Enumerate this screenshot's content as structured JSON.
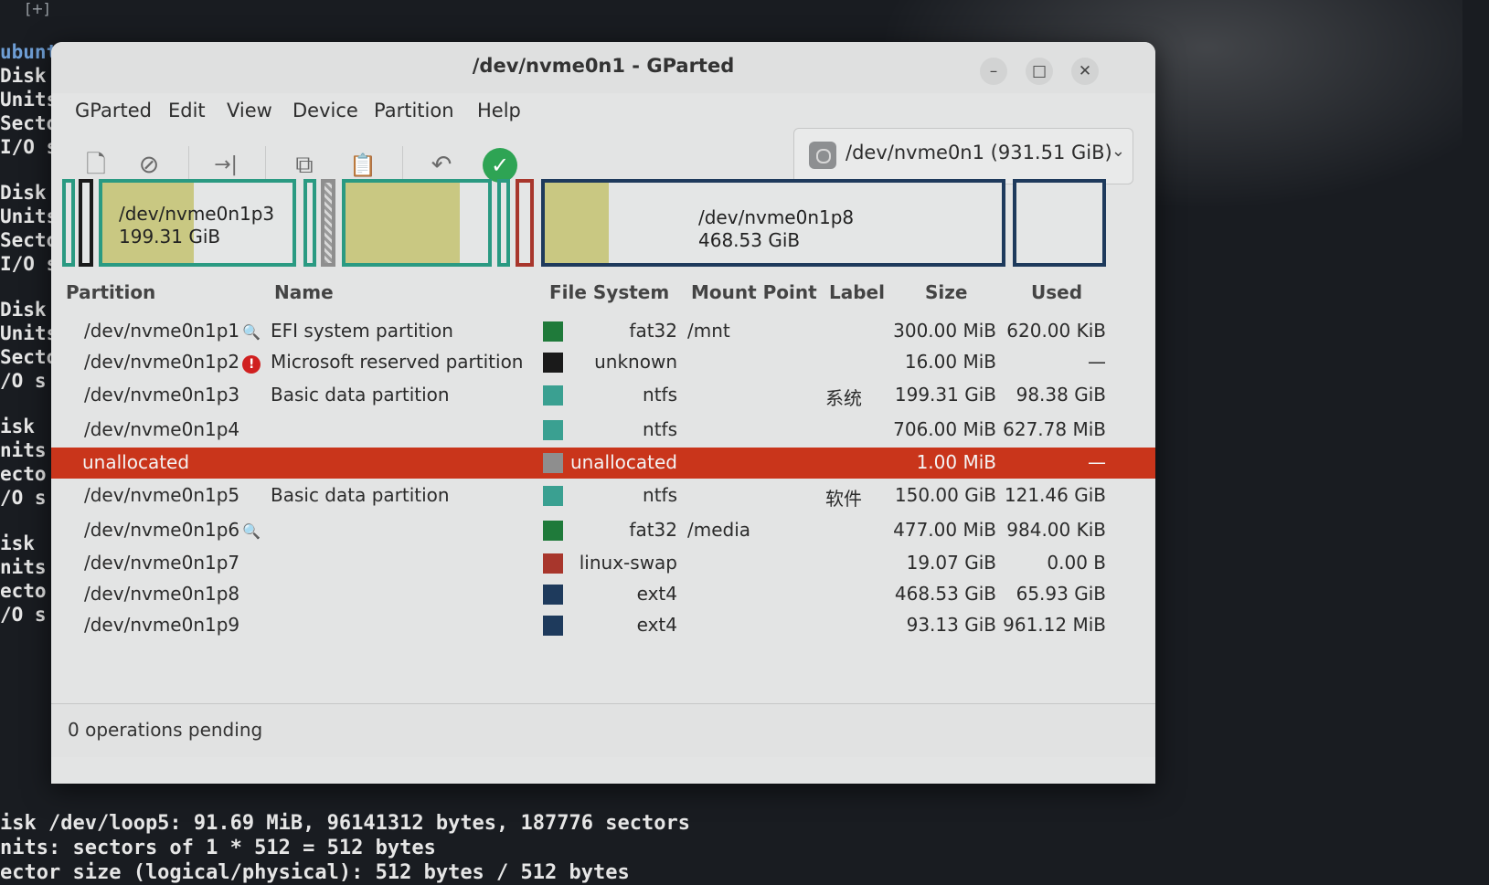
{
  "terminal": {
    "tab_icon": "[+]",
    "side_lines": [
      "ubuntu",
      "Disk ",
      "Units",
      "Secto",
      "I/O s",
      "",
      "Disk ",
      "Units",
      "Secto",
      "I/O s",
      "",
      "Disk ",
      "Units",
      "Secto",
      "/O s",
      "",
      "isk ",
      "nits ",
      "ecto",
      "/O s",
      "",
      "isk ",
      "nits ",
      "ecto",
      "/O s"
    ],
    "bottom_lines": [
      "isk /dev/loop5: 91.69 MiB, 96141312 bytes, 187776 sectors",
      "nits: sectors of 1 * 512 = 512 bytes",
      "ector size (logical/physical): 512 bytes / 512 bytes"
    ]
  },
  "window": {
    "title": "/dev/nvme0n1 - GParted",
    "controls": {
      "minimize": "–",
      "maximize": "□",
      "close": "✕"
    }
  },
  "menu": [
    "GParted",
    "Edit",
    "View",
    "Device",
    "Partition",
    "Help"
  ],
  "toolbar": {
    "new_icon": "🗋",
    "delete_icon": "⊘",
    "resize_icon": "→|",
    "copy_icon": "⧉",
    "paste_icon": "📋",
    "undo_icon": "↶",
    "apply_icon": "✓"
  },
  "device_selector": {
    "value": "/dev/nvme0n1 (931.51 GiB)",
    "chevron": "⌄"
  },
  "disk_map": {
    "p3": {
      "name": "/dev/nvme0n1p3",
      "size": "199.31 GiB"
    },
    "p8": {
      "name": "/dev/nvme0n1p8",
      "size": "468.53 GiB"
    }
  },
  "columns": [
    "Partition",
    "Name",
    "File System",
    "Mount Point",
    "Label",
    "Size",
    "Used"
  ],
  "rows": [
    {
      "partition": "/dev/nvme0n1p1",
      "flag": "🔍",
      "name": "EFI system partition",
      "fs": "fat32",
      "fs_color": "#1f7a3a",
      "mount": "/mnt",
      "label": "",
      "size": "300.00 MiB",
      "used": "620.00 KiB"
    },
    {
      "partition": "/dev/nvme0n1p2",
      "flag": "!",
      "name": "Microsoft reserved partition",
      "fs": "unknown",
      "fs_color": "#1a1a1a",
      "mount": "",
      "label": "",
      "size": "16.00 MiB",
      "used": "—"
    },
    {
      "partition": "/dev/nvme0n1p3",
      "flag": "",
      "name": "Basic data partition",
      "fs": "ntfs",
      "fs_color": "#3aa091",
      "mount": "",
      "label": "系统",
      "size": "199.31 GiB",
      "used": "98.38 GiB"
    },
    {
      "partition": "/dev/nvme0n1p4",
      "flag": "",
      "name": "",
      "fs": "ntfs",
      "fs_color": "#3aa091",
      "mount": "",
      "label": "",
      "size": "706.00 MiB",
      "used": "627.78 MiB"
    },
    {
      "partition": "unallocated",
      "flag": "",
      "name": "",
      "fs": "unallocated",
      "fs_color": "#8e8e8e",
      "mount": "",
      "label": "",
      "size": "1.00 MiB",
      "used": "—"
    },
    {
      "partition": "/dev/nvme0n1p5",
      "flag": "",
      "name": "Basic data partition",
      "fs": "ntfs",
      "fs_color": "#3aa091",
      "mount": "",
      "label": "软件",
      "size": "150.00 GiB",
      "used": "121.46 GiB"
    },
    {
      "partition": "/dev/nvme0n1p6",
      "flag": "🔍",
      "name": "",
      "fs": "fat32",
      "fs_color": "#1f7a3a",
      "mount": "/media",
      "label": "",
      "size": "477.00 MiB",
      "used": "984.00 KiB"
    },
    {
      "partition": "/dev/nvme0n1p7",
      "flag": "",
      "name": "",
      "fs": "linux-swap",
      "fs_color": "#a8362c",
      "mount": "",
      "label": "",
      "size": "19.07 GiB",
      "used": "0.00 B"
    },
    {
      "partition": "/dev/nvme0n1p8",
      "flag": "",
      "name": "",
      "fs": "ext4",
      "fs_color": "#1e3a5c",
      "mount": "",
      "label": "",
      "size": "468.53 GiB",
      "used": "65.93 GiB"
    },
    {
      "partition": "/dev/nvme0n1p9",
      "flag": "",
      "name": "",
      "fs": "ext4",
      "fs_color": "#1e3a5c",
      "mount": "",
      "label": "",
      "size": "93.13 GiB",
      "used": "961.12 MiB"
    }
  ],
  "selected_row": 4,
  "status": "0 operations pending"
}
